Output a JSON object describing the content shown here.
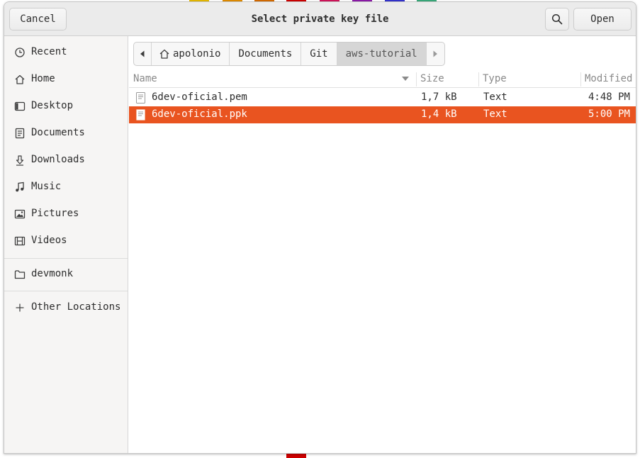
{
  "dialog": {
    "title": "Select private key file",
    "cancel_label": "Cancel",
    "open_label": "Open",
    "search_icon": "search-icon"
  },
  "sidebar": {
    "places": [
      {
        "label": "Recent",
        "icon": "clock-icon"
      },
      {
        "label": "Home",
        "icon": "home-icon"
      },
      {
        "label": "Desktop",
        "icon": "desktop-icon"
      },
      {
        "label": "Documents",
        "icon": "document-icon"
      },
      {
        "label": "Downloads",
        "icon": "download-icon"
      },
      {
        "label": "Music",
        "icon": "music-icon"
      },
      {
        "label": "Pictures",
        "icon": "picture-icon"
      },
      {
        "label": "Videos",
        "icon": "video-icon"
      }
    ],
    "bookmarks": [
      {
        "label": "devmonk",
        "icon": "folder-icon"
      }
    ],
    "other": {
      "label": "Other Locations",
      "icon": "plus-icon"
    }
  },
  "pathbar": {
    "crumbs": [
      "apolonio",
      "Documents",
      "Git",
      "aws-tutorial"
    ],
    "active_index": 3
  },
  "columns": {
    "name": "Name",
    "size": "Size",
    "type": "Type",
    "modified": "Modified"
  },
  "files": [
    {
      "name": "6dev-oficial.pem",
      "size": "1,7 kB",
      "type": "Text",
      "modified": "4:48 PM",
      "selected": false
    },
    {
      "name": "6dev-oficial.ppk",
      "size": "1,4 kB",
      "type": "Text",
      "modified": "5:00 PM",
      "selected": true
    }
  ],
  "colors": {
    "accent": "#e95420",
    "headerbar": "#ebebeb",
    "sidebar": "#f6f5f4"
  }
}
